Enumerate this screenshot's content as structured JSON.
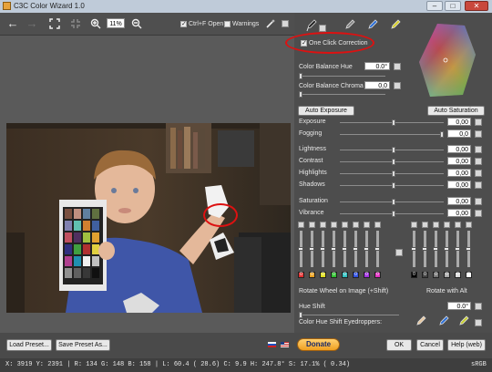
{
  "window": {
    "title": "C3C Color Wizard 1.0",
    "minimize": "–",
    "maximize": "□",
    "close": "✕"
  },
  "toolbar": {
    "zoom_value": "11%",
    "ctrlf_open_label": "Ctrl+F Open",
    "warnings_label": "Warnings"
  },
  "panel": {
    "one_click_label": "One Click Correction",
    "color_balance_hue_label": "Color Balance Hue",
    "color_balance_hue_value": "0.0°",
    "color_balance_chroma_label": "Color Balance Chroma",
    "color_balance_chroma_value": "0,0",
    "auto_exposure_label": "Auto Exposure",
    "auto_saturation_label": "Auto Saturation",
    "sliders": [
      {
        "key": "exposure",
        "label": "Exposure",
        "value": "0,00"
      },
      {
        "key": "fogging",
        "label": "Fogging",
        "value": "0,0"
      },
      {
        "key": "lightness",
        "label": "Lightness",
        "value": "0,00"
      },
      {
        "key": "contrast",
        "label": "Contrast",
        "value": "0,00"
      },
      {
        "key": "highlights",
        "label": "Highlights",
        "value": "0,00"
      },
      {
        "key": "shadows",
        "label": "Shadows",
        "value": "0,00"
      },
      {
        "key": "saturation",
        "label": "Saturation",
        "value": "0,00"
      },
      {
        "key": "vibrance",
        "label": "Vibrance",
        "value": "0,00"
      }
    ],
    "rotate_wheel_label": "Rotate Wheel on Image (+Shift)",
    "rotate_alt_label": "Rotate with Alt",
    "hue_shift_label": "Hue Shift",
    "hue_shift_value": "0.0°",
    "eyedroppers_label": "Color Hue Shift Eyedroppers:",
    "color_channels": [
      "0",
      "0",
      "0",
      "0",
      "0",
      "0",
      "0",
      "0"
    ],
    "gray_channels": [
      "0",
      "0",
      "0",
      "0",
      "0",
      "0"
    ]
  },
  "bottom": {
    "load_preset": "Load Preset...",
    "save_preset": "Save Preset As...",
    "donate": "Donate",
    "ok": "OK",
    "cancel": "Cancel",
    "help": "Help (web)"
  },
  "status": {
    "text": "X: 3919  Y: 2391  | R: 134  G: 148  B: 158  |  L:  60.4 ( 28.6)  C:   9.9  H: 247.8°  S:  17.1% ( 0.34)",
    "profile": "sRGB"
  },
  "colors": {
    "channel_colors": [
      "#e03030",
      "#e8a020",
      "#e0e020",
      "#30c030",
      "#30c0c0",
      "#3050e0",
      "#a030e0",
      "#e030c0"
    ],
    "gray_colors": [
      "#000000",
      "#444444",
      "#777777",
      "#aaaaaa",
      "#dddddd",
      "#ffffff"
    ]
  }
}
